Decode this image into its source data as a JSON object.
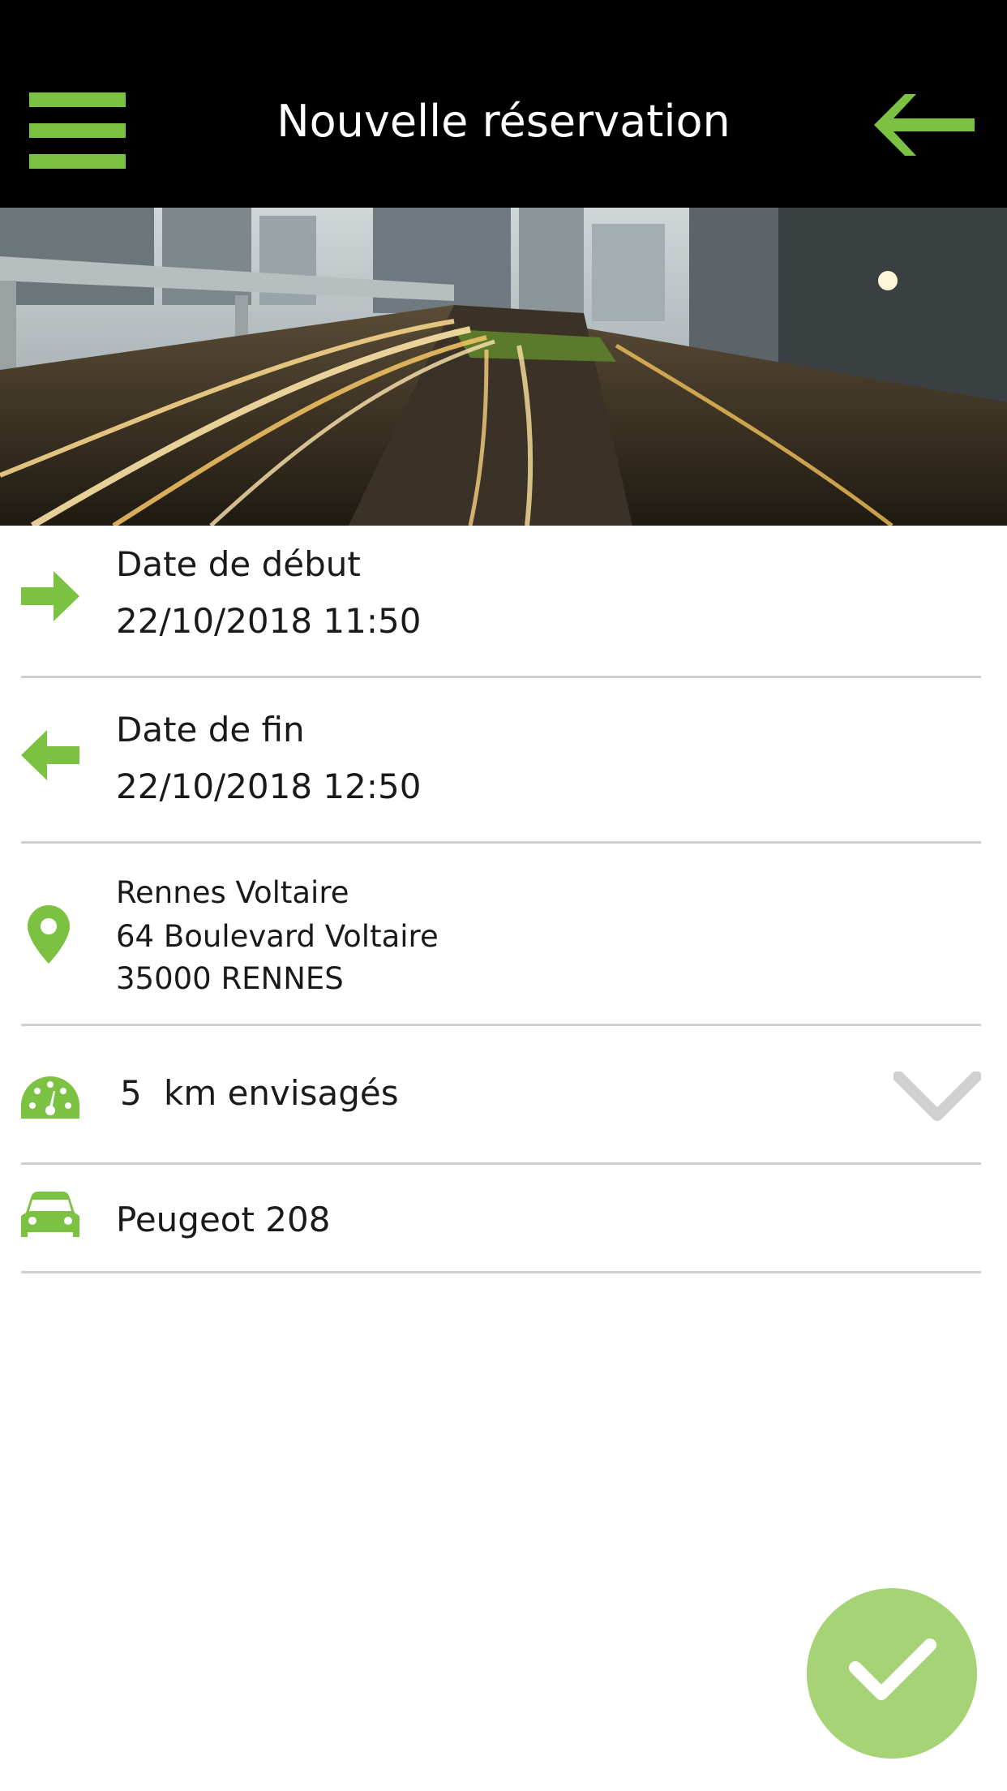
{
  "header": {
    "title": "Nouvelle réservation",
    "menu_icon": "hamburger-menu-icon",
    "back_icon": "arrow-left-icon",
    "accent_color": "#7cc242",
    "background_color": "#000000"
  },
  "banner": {
    "icon": "city-night-traffic-photo"
  },
  "reservation": {
    "start": {
      "label": "Date de début",
      "value": "22/10/2018 11:50",
      "icon": "arrow-right-icon"
    },
    "end": {
      "label": "Date de fin",
      "value": "22/10/2018 12:50",
      "icon": "arrow-left-icon"
    },
    "location": {
      "icon": "map-pin-icon",
      "name": "Rennes Voltaire",
      "street": "64 Boulevard Voltaire",
      "city": "35000 RENNES"
    },
    "distance": {
      "icon": "speedometer-icon",
      "value": "5",
      "unit_label": "km envisagés",
      "dropdown_icon": "chevron-down-icon"
    },
    "vehicle": {
      "icon": "car-icon",
      "name": "Peugeot 208"
    }
  },
  "confirm_button": {
    "icon": "checkmark-icon",
    "color": "#a6d375"
  }
}
